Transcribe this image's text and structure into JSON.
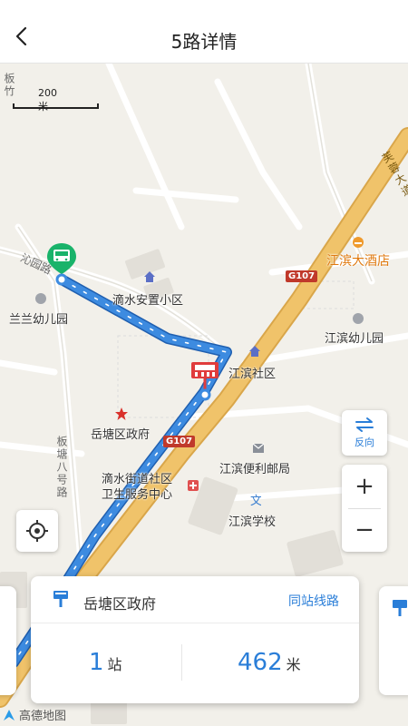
{
  "header": {
    "title": "5路详情"
  },
  "map": {
    "scale_label": "200 米",
    "g107": "G107",
    "labels": {
      "fu_rong": "芙蓉大道",
      "qin_yuan": "沁园路",
      "ban_zhu": "板竹",
      "ban_tang": "板塘八号路",
      "di_shui_an_zhi": "滴水安置小区",
      "lan_lan": "兰兰幼儿园",
      "jiang_bin_she_qu": "江滨社区",
      "yue_tang_gov": "岳塘区政府",
      "di_shui_health": "滴水街道社区\n卫生服务中心",
      "jiang_bin_hotel": "江滨大酒店",
      "jiang_bin_kindergarten": "江滨幼儿园",
      "jiang_bin_post": "江滨便利邮局",
      "jiang_bin_school": "江滨学校"
    }
  },
  "controls": {
    "reverse_label": "反向",
    "zoom_in": "+",
    "zoom_out": "−"
  },
  "stop_card": {
    "stop_name": "岳塘区政府",
    "same_station_lines": "同站线路",
    "stops_count": "1",
    "stops_unit": "站",
    "distance": "462",
    "distance_unit": "米"
  },
  "footer": {
    "logo_text": "高德地图"
  },
  "colors": {
    "accent": "#2a7ed8",
    "route": "#3d8be0",
    "highway": "#f0c36a",
    "bus_green": "#19b36a",
    "stop_red": "#e03c3c"
  }
}
